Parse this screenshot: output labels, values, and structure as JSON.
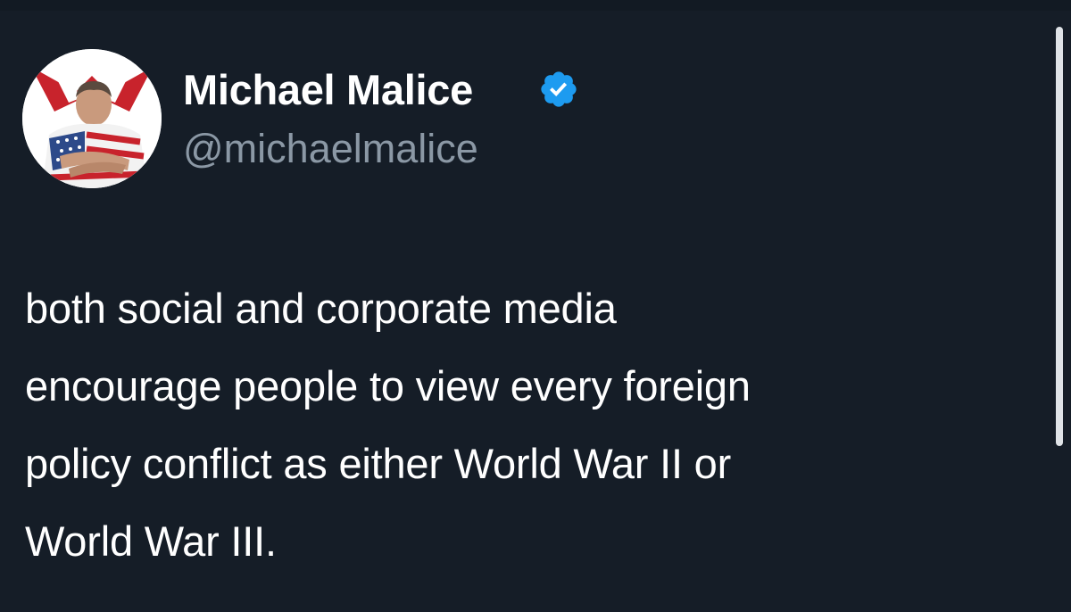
{
  "author": {
    "display_name": "Michael Malice",
    "handle": "@michaelmalice",
    "verified": true,
    "avatar_icon": "profile-photo-american-flag",
    "verified_icon": "verified-badge-icon"
  },
  "tweet": {
    "text": "both social and corporate media\nencourage people to view every foreign\npolicy conflict as either World War II or\nWorld War III."
  },
  "colors": {
    "background": "#151d27",
    "text": "#ffffff",
    "handle": "#8b98a5",
    "verified_badge": "#1d9bf0"
  }
}
